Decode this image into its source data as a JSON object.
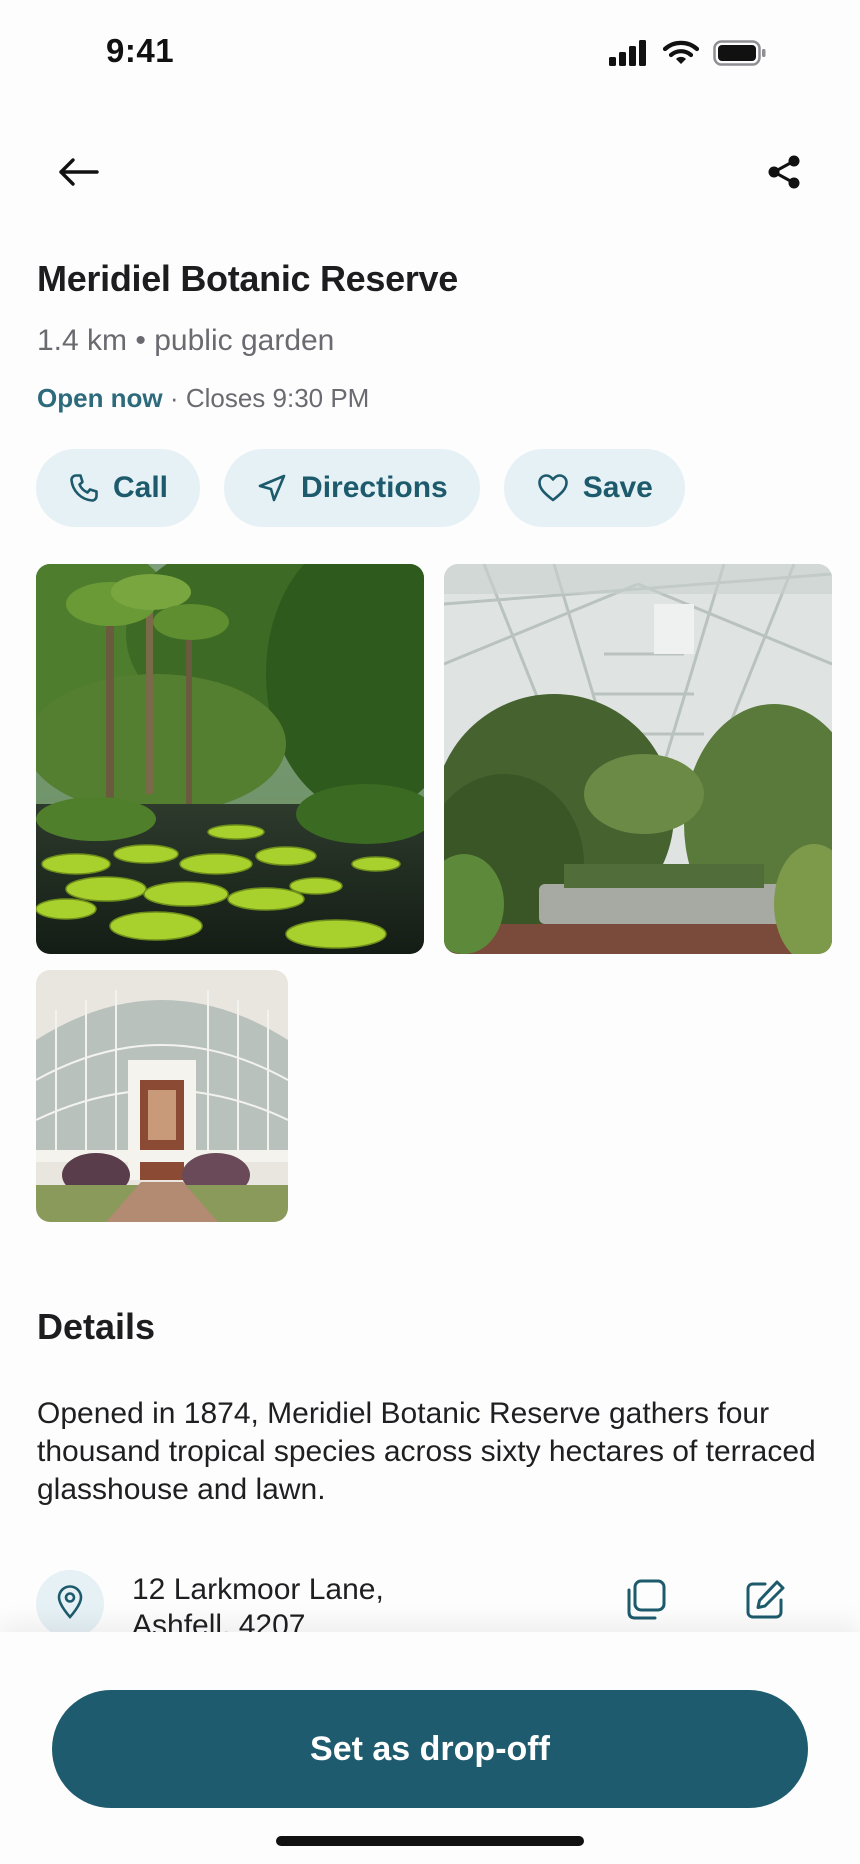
{
  "status_bar": {
    "time": "9:41"
  },
  "place": {
    "title": "Meridiel Botanic Reserve",
    "distance": "1.4 km",
    "category": "public garden",
    "meta_separator": "•",
    "open_status": "Open now",
    "hours_separator": "·",
    "closing": "Closes 9:30 PM"
  },
  "actions": [
    {
      "label": "Call",
      "icon": "phone-icon"
    },
    {
      "label": "Directions",
      "icon": "navigation-arrow-icon"
    },
    {
      "label": "Save",
      "icon": "heart-icon"
    }
  ],
  "photos": [
    {
      "subject": "tropical lily pond"
    },
    {
      "subject": "glasshouse interior"
    },
    {
      "subject": "victorian glasshouse entrance"
    }
  ],
  "details": {
    "heading": "Details",
    "description": "Opened in 1874, Meridiel Botanic Reserve gathers four thousand tropical species across sixty hectares of terraced glasshouse and lawn.",
    "address_line1": "12 Larkmoor Lane,",
    "address_line2": "Ashfell, 4207"
  },
  "cta": {
    "label": "Set as drop-off"
  },
  "colors": {
    "accent": "#1e5b6e",
    "chip_bg": "#e6f1f5",
    "open_status": "#2c6a7c"
  }
}
